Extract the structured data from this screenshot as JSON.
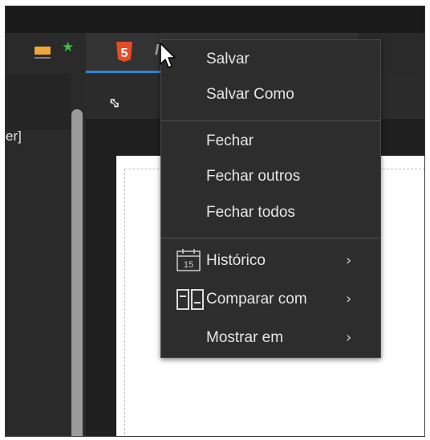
{
  "left_panel": {
    "text": "er]"
  },
  "tab": {
    "label": "I"
  },
  "context_menu": {
    "items": [
      {
        "label": "Salvar"
      },
      {
        "label": "Salvar Como"
      },
      {
        "label": "Fechar"
      },
      {
        "label": "Fechar outros"
      },
      {
        "label": "Fechar todos"
      },
      {
        "label": "Histórico",
        "icon": "calendar-icon",
        "icon_text": "15",
        "submenu": true
      },
      {
        "label": "Comparar com",
        "icon": "compare-icon",
        "submenu": true
      },
      {
        "label": "Mostrar em",
        "submenu": true
      }
    ]
  },
  "html5_badge": "5",
  "colors": {
    "accent": "#2f86d4",
    "html5": "#e44d26",
    "folder": "#f0a63a",
    "star": "#3cbf3c"
  }
}
